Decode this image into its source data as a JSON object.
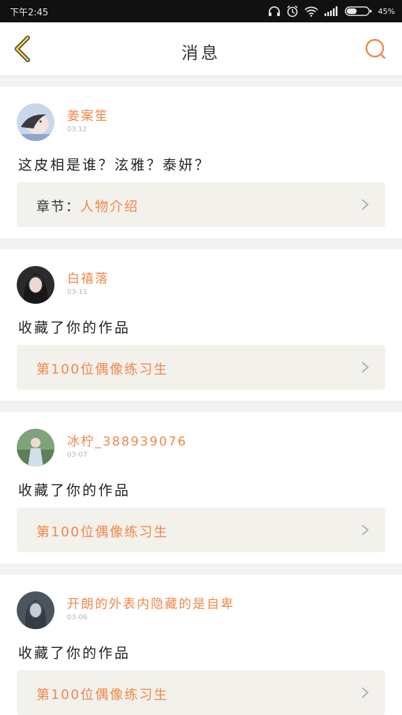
{
  "status_bar": {
    "time": "下午2:45",
    "battery": "45%",
    "icons": [
      "headphones-icon",
      "alarm-icon",
      "wifi-icon",
      "signal-icon",
      "battery-icon"
    ]
  },
  "header": {
    "title": "消息",
    "back_icon": "chevron-left-icon",
    "search_icon": "search-icon"
  },
  "colors": {
    "accent": "#f0884a",
    "back_arrow": "#f5d040",
    "card_ref_bg": "#f2f1ec"
  },
  "messages": [
    {
      "username": "姜案笙",
      "date": "03.12",
      "content": "这皮相是谁？泫雅？泰妍？",
      "ref_label": "章节：",
      "ref_value": "人物介绍"
    },
    {
      "username": "白禧落",
      "date": "03-11",
      "content": "收藏了你的作品",
      "ref_label": "",
      "ref_value": "第100位偶像练习生"
    },
    {
      "username": "冰柠_388939076",
      "date": "03-07",
      "content": "收藏了你的作品",
      "ref_label": "",
      "ref_value": "第100位偶像练习生"
    },
    {
      "username": "开朗的外表内隐藏的是自卑",
      "date": "03-06",
      "content": "收藏了你的作品",
      "ref_label": "",
      "ref_value": "第100位偶像练习生"
    }
  ]
}
